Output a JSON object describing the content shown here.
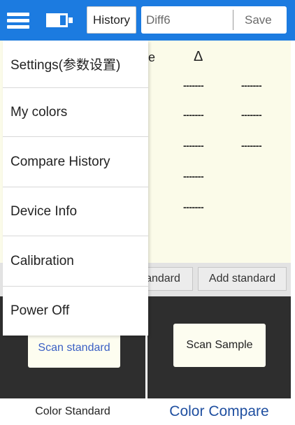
{
  "topbar": {
    "history_label": "History",
    "diff_value": "Diff6",
    "save_label": "Save",
    "accent_color": "#1c7be0"
  },
  "table": {
    "partial_header": "e",
    "delta_header": "Δ",
    "dash": "-------"
  },
  "drawer": {
    "items": [
      {
        "label": "Settings(参数设置)"
      },
      {
        "label": "My colors"
      },
      {
        "label": "Compare History"
      },
      {
        "label": "Device Info"
      },
      {
        "label": "Calibration"
      },
      {
        "label": "Power Off"
      }
    ]
  },
  "buttons": {
    "standard_partial": "andard",
    "add_standard": "Add standard",
    "scan_standard": "Scan standard",
    "scan_sample": "Scan Sample"
  },
  "tabs": {
    "color_standard": "Color Standard",
    "color_compare": "Color Compare",
    "active_color": "#1f4fa0"
  }
}
